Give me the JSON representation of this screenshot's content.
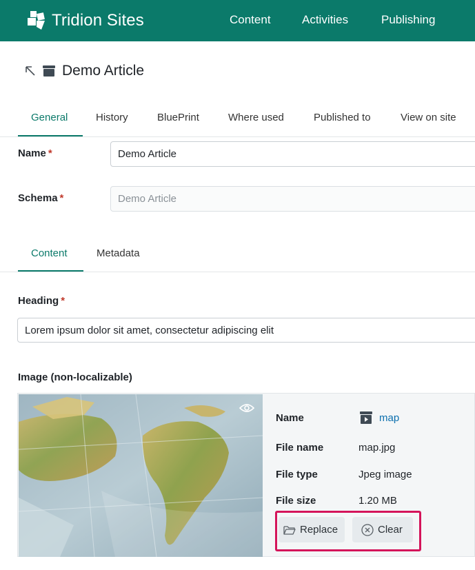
{
  "app": {
    "name": "Tridion Sites"
  },
  "nav": {
    "items": [
      "Content",
      "Activities",
      "Publishing"
    ]
  },
  "item": {
    "title": "Demo Article"
  },
  "tabs": {
    "items": [
      "General",
      "History",
      "BluePrint",
      "Where used",
      "Published to",
      "View on site"
    ],
    "active": "General"
  },
  "fields": {
    "name": {
      "label": "Name",
      "required_mark": "*",
      "value": "Demo Article"
    },
    "schema": {
      "label": "Schema",
      "required_mark": "*",
      "value": "Demo Article"
    }
  },
  "subtabs": {
    "items": [
      "Content",
      "Metadata"
    ],
    "active": "Content"
  },
  "heading": {
    "label": "Heading",
    "required_mark": "*",
    "value": "Lorem ipsum dolor sit amet, consectetur adipiscing elit"
  },
  "image": {
    "label": "Image (non-localizable)",
    "meta": {
      "name_label": "Name",
      "name_value": "map",
      "file_name_label": "File name",
      "file_name_value": "map.jpg",
      "file_type_label": "File type",
      "file_type_value": "Jpeg image",
      "file_size_label": "File size",
      "file_size_value": "1.20 MB"
    },
    "actions": {
      "replace": "Replace",
      "clear": "Clear"
    }
  },
  "colors": {
    "brand": "#0b7a6a",
    "link": "#0b6fae",
    "required": "#c0392b",
    "highlight": "#d4145a"
  },
  "icons": [
    "tridion-logo-icon",
    "navigate-up-icon",
    "component-icon",
    "preview-eye-icon",
    "multimedia-icon",
    "folder-open-icon",
    "clear-circle-icon"
  ]
}
